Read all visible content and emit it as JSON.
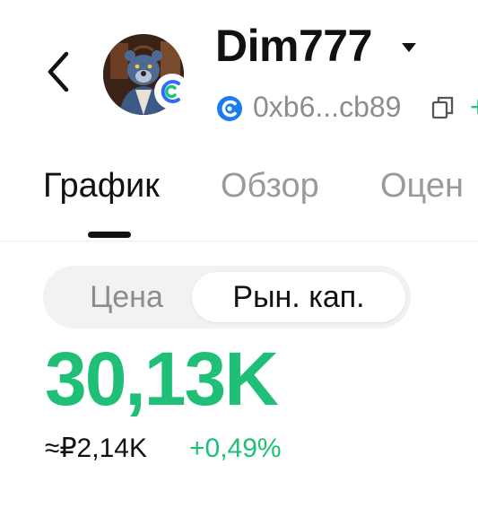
{
  "header": {
    "back_icon": "chevron-left-icon",
    "avatar_icon": "bear-avatar",
    "avatar_badge_icon": "exchange-badge-icon",
    "token_name": "Dim777",
    "name_dropdown_icon": "caret-down-icon",
    "chain_icon": "chain-logo-icon",
    "address": "0xb6...cb89",
    "copy_icon": "copy-icon",
    "add_icon": "+"
  },
  "tabs": [
    {
      "label": "График",
      "active": true
    },
    {
      "label": "Обзор",
      "active": false
    },
    {
      "label": "Оцен",
      "active": false
    }
  ],
  "segmented": {
    "options": [
      {
        "label": "Цена",
        "active": false
      },
      {
        "label": "Рын. кап.",
        "active": true
      }
    ]
  },
  "metrics": {
    "market_cap": "30,13K",
    "fiat_value": "≈₽2,14K",
    "change": "+0,49%"
  },
  "colors": {
    "positive": "#1fbf78",
    "chain_blue": "#1a7cf0",
    "muted_text": "#8c8c8c"
  }
}
